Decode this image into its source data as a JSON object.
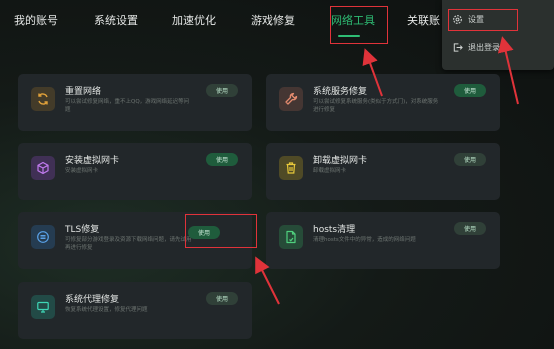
{
  "nav": {
    "items": [
      {
        "label": "我的账号"
      },
      {
        "label": "系统设置"
      },
      {
        "label": "加速优化"
      },
      {
        "label": "游戏修复"
      },
      {
        "label": "网络工具"
      },
      {
        "label": "关联账"
      }
    ],
    "active_index": 4
  },
  "dropdown": {
    "items": [
      {
        "label": "设置",
        "icon": "gear-icon"
      },
      {
        "label": "退出登录",
        "icon": "logout-icon"
      }
    ]
  },
  "tools": [
    {
      "title": "重置网络",
      "desc": "可以尝试修复网络，重不上QQ，游戏网络延迟等问题",
      "button": "使用",
      "icon": "refresh-icon",
      "color": "#c98a2a"
    },
    {
      "title": "系统服务修复",
      "desc": "可以尝试修复系统服务(类似于方式门)，对系统服务进行修复",
      "button": "使用",
      "icon": "wrench-icon",
      "color": "#d0745a"
    },
    {
      "title": "安装虚拟网卡",
      "desc": "安装虚拟网卡",
      "button": "使用",
      "icon": "box-icon",
      "color": "#9d4dd6"
    },
    {
      "title": "卸载虚拟网卡",
      "desc": "卸载虚拟网卡",
      "button": "使用",
      "icon": "trash-icon",
      "color": "#d8b21c"
    },
    {
      "title": "TLS修复",
      "desc": "可修复部分游戏登录及资源下载网络问题，请先试用再进行修复",
      "button": "使用",
      "icon": "tls-icon",
      "color": "#2f7cc8"
    },
    {
      "title": "hosts清理",
      "desc": "清理hosts文件中的异常，造成的网络问题",
      "button": "使用",
      "icon": "file-icon",
      "color": "#34b865"
    },
    {
      "title": "系统代理修复",
      "desc": "恢复系统代理设置，修复代理问题",
      "button": "使用",
      "icon": "monitor-icon",
      "color": "#23b59a"
    }
  ],
  "colors": {
    "accent": "#2ebd74",
    "highlight": "#e0333a"
  }
}
